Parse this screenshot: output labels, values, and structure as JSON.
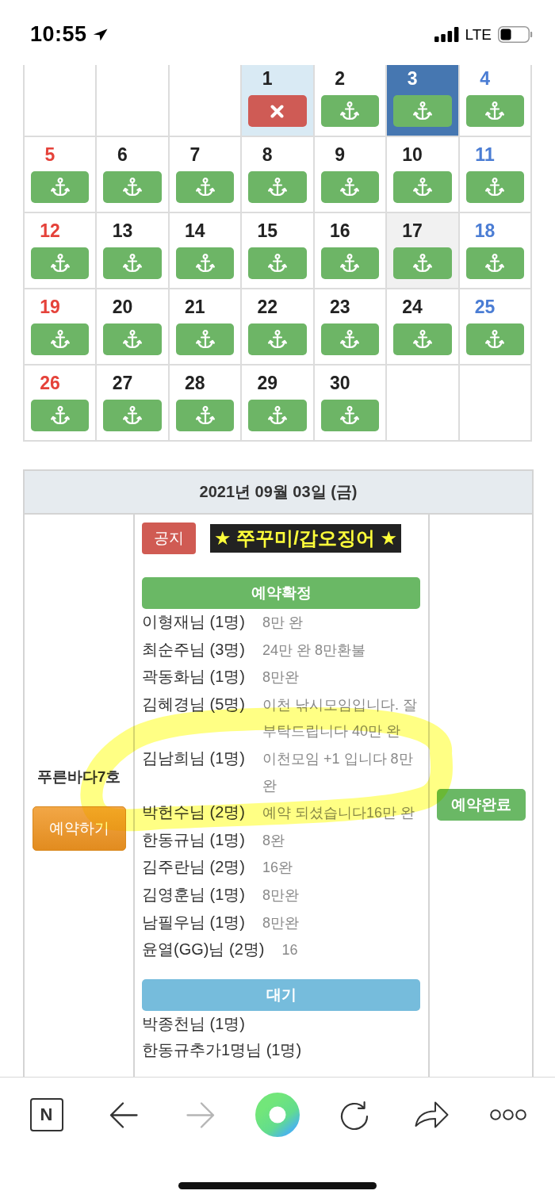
{
  "status_bar": {
    "time": "10:55",
    "network": "LTE"
  },
  "calendar": {
    "weeks": [
      [
        {
          "kind": "empty"
        },
        {
          "kind": "empty"
        },
        {
          "kind": "empty"
        },
        {
          "day": "1",
          "kind": "closed",
          "selected": false,
          "color": "#d9eaf4"
        },
        {
          "day": "2",
          "kind": "open",
          "selected": false
        },
        {
          "day": "3",
          "kind": "open",
          "selected": true
        },
        {
          "day": "4",
          "kind": "open",
          "selected": false
        }
      ],
      [
        {
          "day": "5",
          "kind": "open",
          "selected": false
        },
        {
          "day": "6",
          "kind": "open",
          "selected": false
        },
        {
          "day": "7",
          "kind": "open",
          "selected": false
        },
        {
          "day": "8",
          "kind": "open",
          "selected": false
        },
        {
          "day": "9",
          "kind": "open",
          "selected": false
        },
        {
          "day": "10",
          "kind": "open",
          "selected": false
        },
        {
          "day": "11",
          "kind": "open",
          "selected": false
        }
      ],
      [
        {
          "day": "12",
          "kind": "open",
          "selected": false
        },
        {
          "day": "13",
          "kind": "open",
          "selected": false
        },
        {
          "day": "14",
          "kind": "open",
          "selected": false
        },
        {
          "day": "15",
          "kind": "open",
          "selected": false
        },
        {
          "day": "16",
          "kind": "open",
          "selected": false
        },
        {
          "day": "17",
          "kind": "open",
          "selected": false,
          "color": "#f1f1f1"
        },
        {
          "day": "18",
          "kind": "open",
          "selected": false
        }
      ],
      [
        {
          "day": "19",
          "kind": "open",
          "selected": false
        },
        {
          "day": "20",
          "kind": "open",
          "selected": false
        },
        {
          "day": "21",
          "kind": "open",
          "selected": false
        },
        {
          "day": "22",
          "kind": "open",
          "selected": false
        },
        {
          "day": "23",
          "kind": "open",
          "selected": false
        },
        {
          "day": "24",
          "kind": "open",
          "selected": false
        },
        {
          "day": "25",
          "kind": "open",
          "selected": false
        }
      ],
      [
        {
          "day": "26",
          "kind": "open",
          "selected": false
        },
        {
          "day": "27",
          "kind": "open",
          "selected": false
        },
        {
          "day": "28",
          "kind": "open",
          "selected": false
        },
        {
          "day": "29",
          "kind": "open",
          "selected": false
        },
        {
          "day": "30",
          "kind": "open",
          "selected": false
        },
        {
          "kind": "empty"
        },
        {
          "kind": "empty"
        }
      ]
    ]
  },
  "detail": {
    "date": "2021년 09월 03일 (금)",
    "boat": {
      "name": "푸른바다7호",
      "button": "예약하기"
    },
    "notice": {
      "badge": "공지",
      "title": "★ 쭈꾸미/갑오징어 ★"
    },
    "groups": [
      {
        "kind": "confirmed",
        "title": "예약확정",
        "entries": [
          {
            "name": "이형재님 (1명)",
            "memo": "8만 완"
          },
          {
            "name": "최순주님 (3명)",
            "memo": "24만 완 8만환불"
          },
          {
            "name": "곽동화님 (1명)",
            "memo": "8만완"
          },
          {
            "name": "김혜경님 (5명)",
            "memo": "이천 낚시모임입니다. 잘 부탁드립니다 40만 완"
          },
          {
            "name": "김남희님 (1명)",
            "memo": "이천모임 +1 입니다 8만 완"
          },
          {
            "name": "박헌수님 (2명)",
            "memo": "예약 되셨습니다16만 완"
          },
          {
            "name": "한동규님 (1명)",
            "memo": "8완"
          },
          {
            "name": "김주란님 (2명)",
            "memo": "16완"
          },
          {
            "name": "김영훈님 (1명)",
            "memo": "8만완"
          },
          {
            "name": "남필우님 (1명)",
            "memo": "8만완"
          },
          {
            "name": "윤열(GG)님 (2명)",
            "memo": "16"
          }
        ]
      },
      {
        "kind": "waiting",
        "title": "대기",
        "entries": [
          {
            "name": "박종천님 (1명)"
          },
          {
            "name": "한동규추가1명님 (1명)"
          }
        ]
      }
    ],
    "status": "예약완료"
  },
  "toolbar": {
    "items": [
      {
        "kind": "logo",
        "label": "N"
      },
      {
        "kind": "back",
        "disabled": false
      },
      {
        "kind": "forward",
        "disabled": true
      },
      {
        "kind": "ring"
      },
      {
        "kind": "reload"
      },
      {
        "kind": "share"
      },
      {
        "kind": "more"
      }
    ]
  },
  "annotation": {
    "kind": "highlighter_loop"
  }
}
